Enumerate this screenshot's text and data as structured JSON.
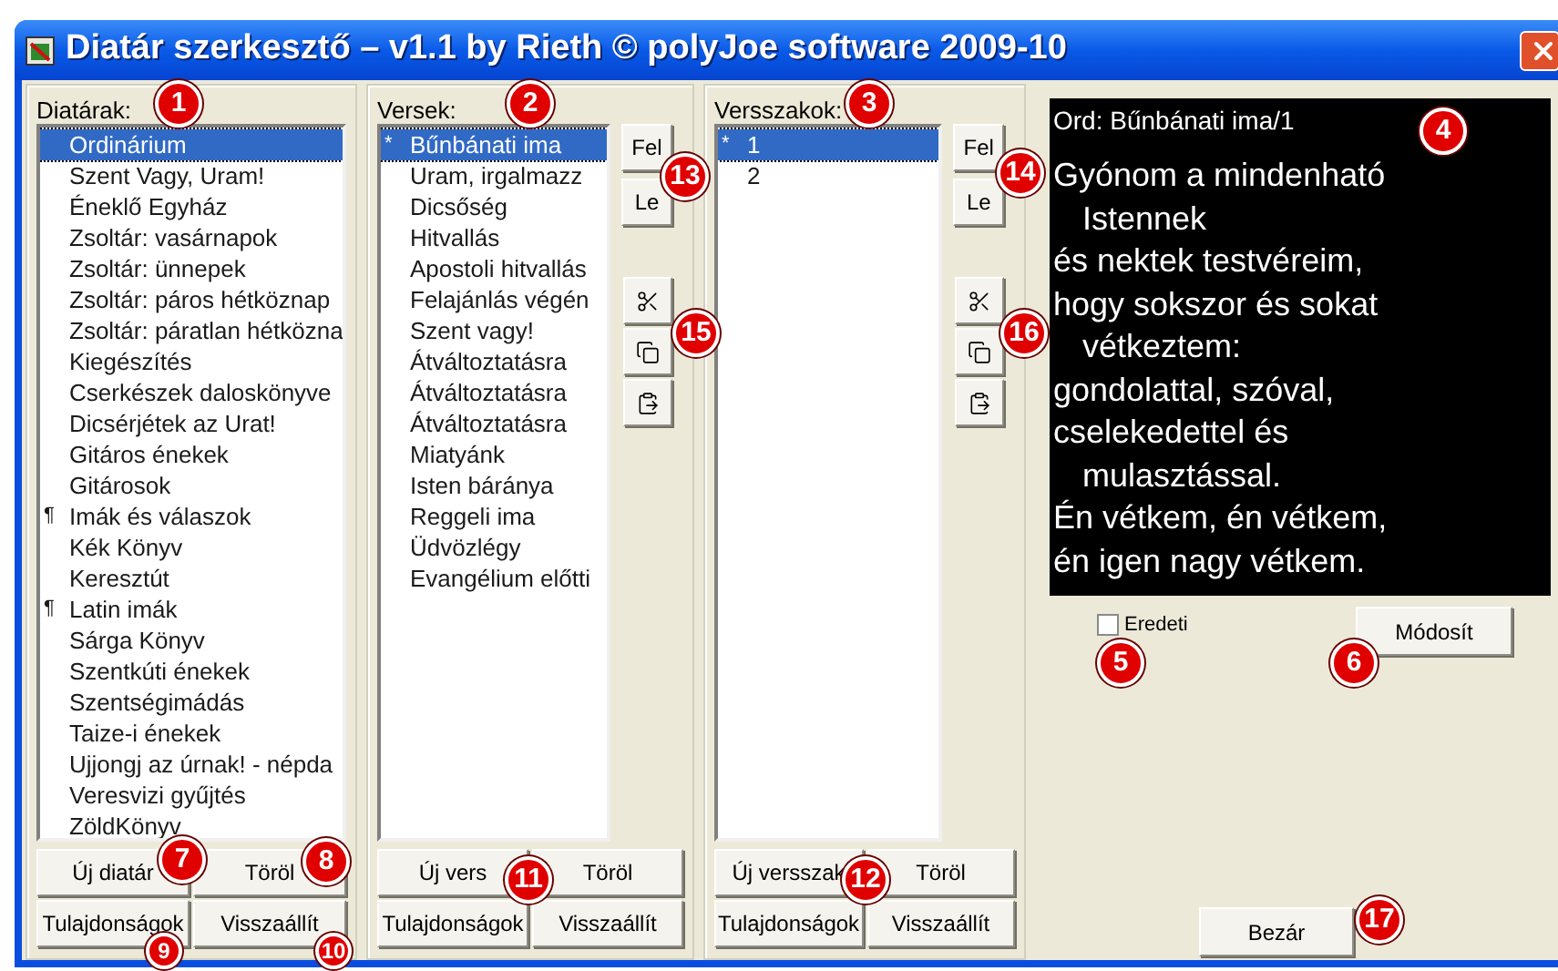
{
  "window": {
    "title": "Diatár szerkesztő – v1.1 by Rieth © polyJoe software 2009-10"
  },
  "diatarak": {
    "label": "Diatárak:",
    "items": [
      {
        "text": "Ordinárium",
        "selected": true
      },
      {
        "text": "Szent Vagy, Uram!",
        "selected": false
      },
      {
        "text": "Éneklő Egyház",
        "selected": false
      },
      {
        "text": "Zsoltár: vasárnapok",
        "selected": false
      },
      {
        "text": "Zsoltár: ünnepek",
        "selected": false
      },
      {
        "text": "Zsoltár: páros hétköznap",
        "selected": false
      },
      {
        "text": "Zsoltár: páratlan hétközna",
        "selected": false
      },
      {
        "text": "Kiegészítés",
        "selected": false
      },
      {
        "text": "Cserkészek daloskönyve",
        "selected": false
      },
      {
        "text": "Dicsérjétek az Urat!",
        "selected": false
      },
      {
        "text": "Gitáros énekek",
        "selected": false
      },
      {
        "text": "Gitárosok",
        "selected": false
      },
      {
        "text": "Imák és válaszok",
        "marker": "¶",
        "selected": false
      },
      {
        "text": "Kék Könyv",
        "selected": false
      },
      {
        "text": "Keresztút",
        "selected": false
      },
      {
        "text": "Latin imák",
        "marker": "¶",
        "selected": false
      },
      {
        "text": "Sárga Könyv",
        "selected": false
      },
      {
        "text": "Szentkúti énekek",
        "selected": false
      },
      {
        "text": "Szentségimádás",
        "selected": false
      },
      {
        "text": "Taize-i énekek",
        "selected": false
      },
      {
        "text": "Ujjongj az úrnak! - népda",
        "selected": false
      },
      {
        "text": "Veresvizi gyűjtés",
        "selected": false
      },
      {
        "text": "ZöldKönyv",
        "selected": false
      }
    ],
    "buttons": [
      "Új diatár",
      "Töröl",
      "Tulajdonságok",
      "Visszaállít"
    ]
  },
  "versek": {
    "label": "Versek:",
    "items": [
      {
        "text": "Bűnbánati ima",
        "marker": "*",
        "selected": true
      },
      {
        "text": "Uram, irgalmazz",
        "selected": false
      },
      {
        "text": "Dicsőség",
        "selected": false
      },
      {
        "text": "Hitvallás",
        "selected": false
      },
      {
        "text": "Apostoli hitvallás",
        "selected": false
      },
      {
        "text": "Felajánlás végén",
        "selected": false
      },
      {
        "text": "Szent vagy!",
        "selected": false
      },
      {
        "text": "Átváltoztatásra",
        "selected": false
      },
      {
        "text": "Átváltoztatásra",
        "selected": false
      },
      {
        "text": "Átváltoztatásra",
        "selected": false
      },
      {
        "text": "Miatyánk",
        "selected": false
      },
      {
        "text": "Isten báránya",
        "selected": false
      },
      {
        "text": "Reggeli ima",
        "selected": false
      },
      {
        "text": "Üdvözlégy",
        "selected": false
      },
      {
        "text": "Evangélium előtti",
        "selected": false
      }
    ],
    "side_buttons": [
      "Fel",
      "Le"
    ],
    "buttons": [
      "Új vers",
      "Töröl",
      "Tulajdonságok",
      "Visszaállít"
    ]
  },
  "versszakok": {
    "label": "Versszakok:",
    "items": [
      {
        "text": "1",
        "marker": "*",
        "selected": true
      },
      {
        "text": "2",
        "selected": false
      }
    ],
    "side_buttons": [
      "Fel",
      "Le"
    ],
    "buttons": [
      "Új versszak",
      "Töröl",
      "Tulajdonságok",
      "Visszaállít"
    ]
  },
  "preview": {
    "header": "Ord: Bűnbánati ima/1",
    "lines": [
      {
        "text": "Gyónom a mindenható",
        "indent": false
      },
      {
        "text": "Istennek",
        "indent": true
      },
      {
        "text": "és nektek testvéreim,",
        "indent": false
      },
      {
        "text": "hogy sokszor és sokat",
        "indent": false
      },
      {
        "text": "vétkeztem:",
        "indent": true
      },
      {
        "text": "gondolattal, szóval,",
        "indent": false
      },
      {
        "text": "cselekedettel és",
        "indent": false
      },
      {
        "text": "mulasztással.",
        "indent": true
      },
      {
        "text": "Én vétkem, én vétkem,",
        "indent": false
      },
      {
        "text": "én igen nagy vétkem.",
        "indent": false
      }
    ]
  },
  "original_checkbox": {
    "label": "Eredeti",
    "checked": false
  },
  "modify_button": "Módosít",
  "close_button": "Bezár",
  "callouts": [
    "1",
    "2",
    "3",
    "4",
    "5",
    "6",
    "7",
    "8",
    "9",
    "10",
    "11",
    "12",
    "13",
    "14",
    "15",
    "16",
    "17"
  ]
}
